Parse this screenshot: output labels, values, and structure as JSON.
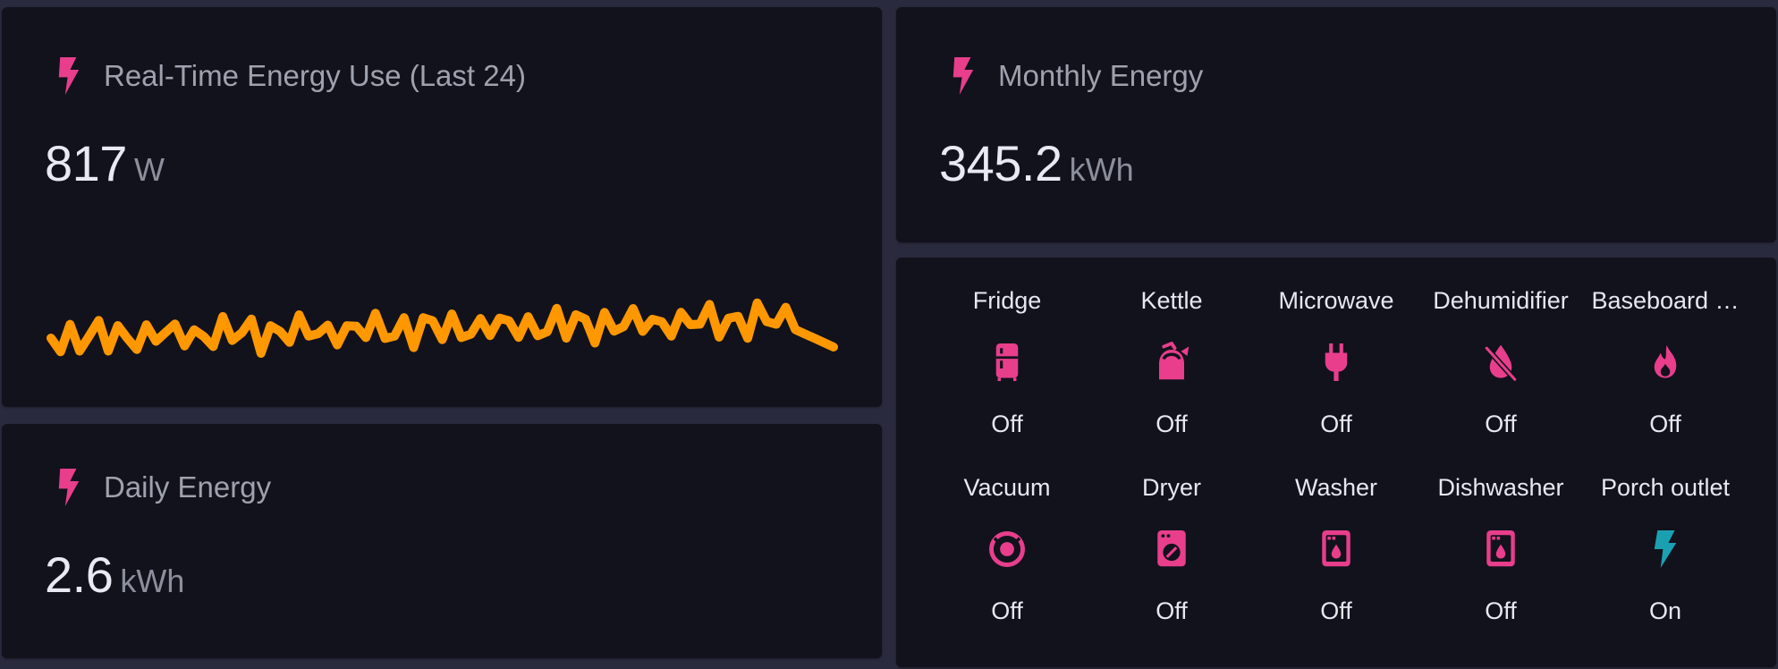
{
  "colors": {
    "accent_icon": "#e83e8c",
    "on_icon": "#1ba0b2",
    "sparkline": "#ff9800",
    "card_bg": "#12121c",
    "page_bg": "#2a2a3e"
  },
  "realtime": {
    "title": "Real-Time Energy Use (Last 24)",
    "icon": "flash-icon",
    "value": "817",
    "unit": "W"
  },
  "monthly": {
    "title": "Monthly Energy",
    "icon": "flash-icon",
    "value": "345.2",
    "unit": "kWh"
  },
  "daily": {
    "title": "Daily Energy",
    "icon": "flash-icon",
    "value": "2.6",
    "unit": "kWh"
  },
  "devices": [
    {
      "name": "Fridge",
      "icon": "fridge-icon",
      "state": "Off"
    },
    {
      "name": "Kettle",
      "icon": "kettle-icon",
      "state": "Off"
    },
    {
      "name": "Microwave",
      "icon": "power-plug-icon",
      "state": "Off"
    },
    {
      "name": "Dehumidifier",
      "icon": "water-off-icon",
      "state": "Off"
    },
    {
      "name": "Baseboard …",
      "icon": "fire-icon",
      "state": "Off"
    },
    {
      "name": "Vacuum",
      "icon": "robot-vacuum-icon",
      "state": "Off"
    },
    {
      "name": "Dryer",
      "icon": "tumble-dryer-icon",
      "state": "Off"
    },
    {
      "name": "Washer",
      "icon": "washing-machine-icon",
      "state": "Off"
    },
    {
      "name": "Dishwasher",
      "icon": "dishwasher-icon",
      "state": "Off"
    },
    {
      "name": "Porch outlet",
      "icon": "flash-icon",
      "state": "On"
    }
  ]
}
